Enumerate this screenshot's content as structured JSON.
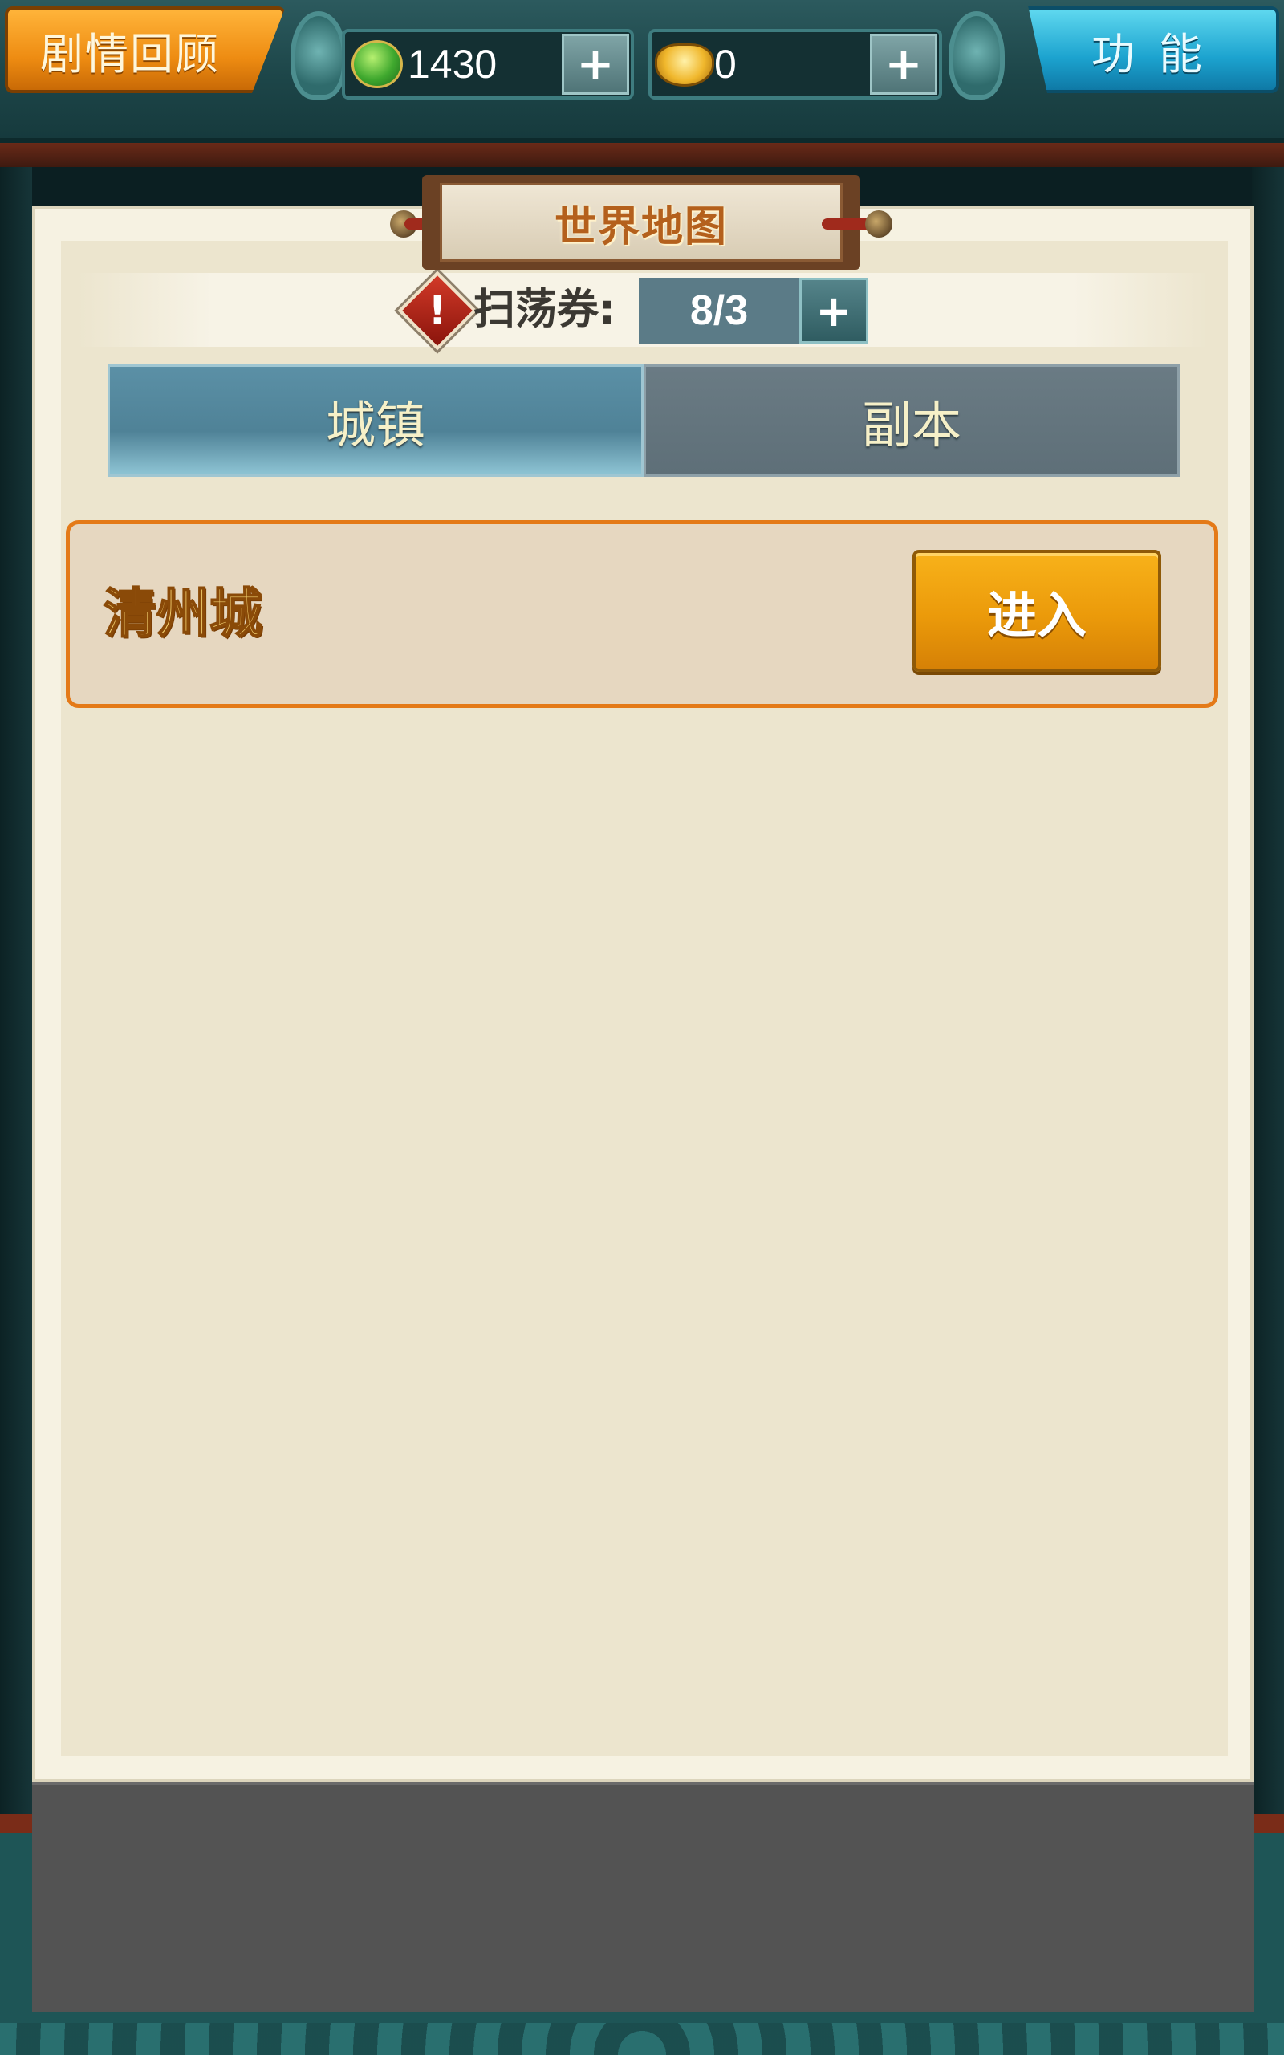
{
  "hud": {
    "story_button": "剧情回顾",
    "function_button": "功能",
    "jade_amount": "1430",
    "gold_amount": "0",
    "plus": "+"
  },
  "panel": {
    "title": "世界地图",
    "ticket_label": "扫荡券:",
    "ticket_value": "8/3",
    "ticket_plus": "+",
    "warning_mark": "!"
  },
  "tabs": [
    {
      "label": "城镇",
      "active": true
    },
    {
      "label": "副本",
      "active": false
    }
  ],
  "locations": [
    {
      "name": "清州城",
      "action": "进入"
    }
  ],
  "colors": {
    "accent_orange": "#ee8c12",
    "accent_blue": "#1ca3cf",
    "card_border": "#e47a18"
  }
}
